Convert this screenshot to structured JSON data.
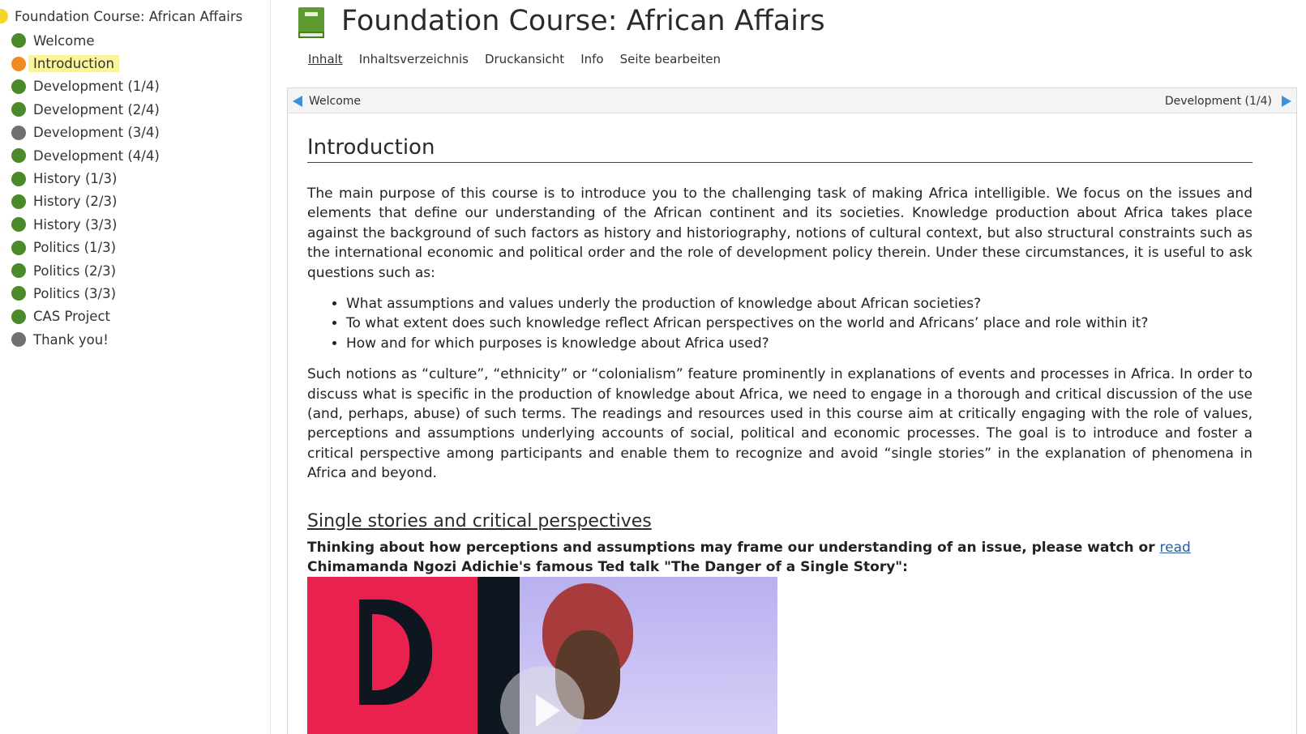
{
  "sidebar": {
    "root": {
      "label": "Foundation Course: African Affairs",
      "color": "#f2d72a"
    },
    "items": [
      {
        "label": "Welcome",
        "color": "#4a8a2a",
        "active": false
      },
      {
        "label": "Introduction",
        "color": "#f08a24",
        "active": true
      },
      {
        "label": "Development (1/4)",
        "color": "#4a8a2a",
        "active": false
      },
      {
        "label": "Development (2/4)",
        "color": "#4a8a2a",
        "active": false
      },
      {
        "label": "Development (3/4)",
        "color": "#707070",
        "active": false
      },
      {
        "label": "Development (4/4)",
        "color": "#4a8a2a",
        "active": false
      },
      {
        "label": "History (1/3)",
        "color": "#4a8a2a",
        "active": false
      },
      {
        "label": "History (2/3)",
        "color": "#4a8a2a",
        "active": false
      },
      {
        "label": "History (3/3)",
        "color": "#4a8a2a",
        "active": false
      },
      {
        "label": "Politics (1/3)",
        "color": "#4a8a2a",
        "active": false
      },
      {
        "label": "Politics (2/3)",
        "color": "#4a8a2a",
        "active": false
      },
      {
        "label": "Politics (3/3)",
        "color": "#4a8a2a",
        "active": false
      },
      {
        "label": "CAS Project",
        "color": "#4a8a2a",
        "active": false
      },
      {
        "label": "Thank you!",
        "color": "#707070",
        "active": false
      }
    ]
  },
  "header": {
    "title": "Foundation Course: African Affairs",
    "icon": "book-icon",
    "tabs": [
      {
        "label": "Inhalt",
        "current": true
      },
      {
        "label": "Inhaltsverzeichnis",
        "current": false
      },
      {
        "label": "Druckansicht",
        "current": false
      },
      {
        "label": "Info",
        "current": false
      },
      {
        "label": "Seite bearbeiten",
        "current": false
      }
    ]
  },
  "nav": {
    "prev_label": "Welcome",
    "next_label": "Development (1/4)",
    "arrow_color": "#3d8fe0"
  },
  "article": {
    "heading": "Introduction",
    "intro": "The main purpose of this course is to introduce you to the challenging task of making Africa intelligible. We focus on  the  issues  and elements  that  define  our  understanding  of  the  African  continent and its societies. Knowledge production about Africa takes place against the background of such factors as history and historiography, notions of cultural context, but also structural constraints such as the international economic and political order and the role of development policy therein. Under these circumstances, it is useful to ask questions such as:",
    "bullets": [
      "What assumptions and values underly the production of knowledge about African societies?",
      "To what extent does such knowledge reflect African perspectives on the world and Africans’ place and role within it?",
      "How and for which purposes is knowledge about Africa used?"
    ],
    "second_para": "Such notions as “culture”, “ethnicity” or “colonialism” feature prominently in explanations of events and processes in Africa. In order to discuss what is specific in the production of knowledge about Africa, we need to engage in a thorough and critical discussion of the use (and, perhaps, abuse) of such terms. The readings and resources used in this course aim at critically engaging with the role of values, perceptions and assumptions underlying accounts of social, political and economic processes. The goal is to introduce and foster a critical perspective among participants and enable them to recognize and avoid “single stories” in the explanation of phenomena in Africa and beyond.",
    "subheading": "Single stories and critical perspectives",
    "prompt_before": "Thinking about how perceptions and assumptions may frame our understanding of an issue, please watch or ",
    "prompt_link": "read",
    "prompt_after": "Chimamanda Ngozi Adichie's famous Ted talk \"The Danger of a Single Story\":"
  }
}
